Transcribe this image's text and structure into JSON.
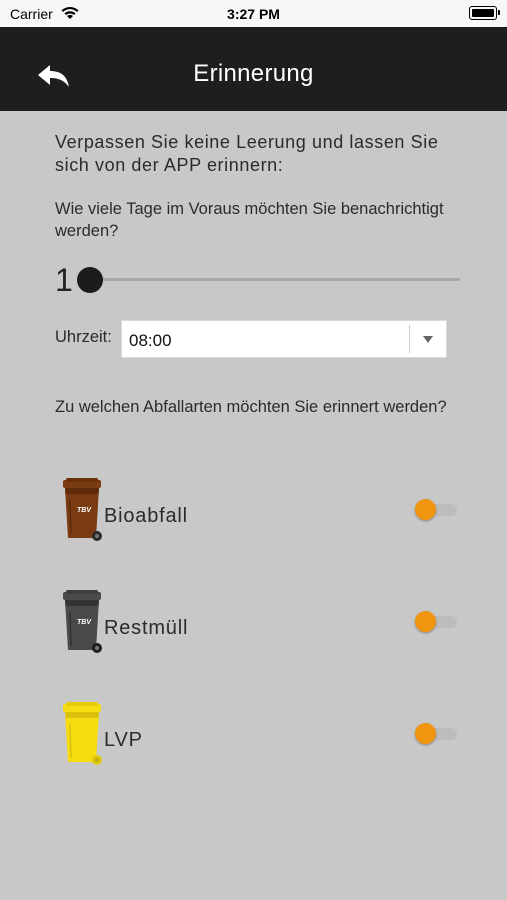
{
  "status_bar": {
    "carrier": "Carrier",
    "time": "3:27 PM"
  },
  "header": {
    "title": "Erinnerung",
    "back_icon": "back-arrow-icon"
  },
  "intro_text": "Verpassen Sie keine Leerung und lassen Sie sich von der APP erinnern:",
  "days_question": "Wie viele Tage im Voraus möchten Sie benachrichtigt werden?",
  "days_slider": {
    "value": "1",
    "min": 1,
    "max": 7,
    "position_fraction": 0.0
  },
  "time": {
    "label": "Uhrzeit:",
    "value": "08:00"
  },
  "waste_question": "Zu welchen Abfallarten möchten Sie erinnert werden?",
  "waste_types": [
    {
      "name": "Bioabfall",
      "bin_color": "#7a3b12",
      "bin_label": "TBV",
      "toggle_on": false
    },
    {
      "name": "Restmüll",
      "bin_color": "#4a4a4a",
      "bin_label": "TBV",
      "toggle_on": false
    },
    {
      "name": "LVP",
      "bin_color": "#f5dd12",
      "bin_label": "",
      "toggle_on": false
    }
  ],
  "colors": {
    "nav_bg": "#1e1e1e",
    "page_bg": "#c8c8c8",
    "toggle_accent": "#f0960f"
  }
}
